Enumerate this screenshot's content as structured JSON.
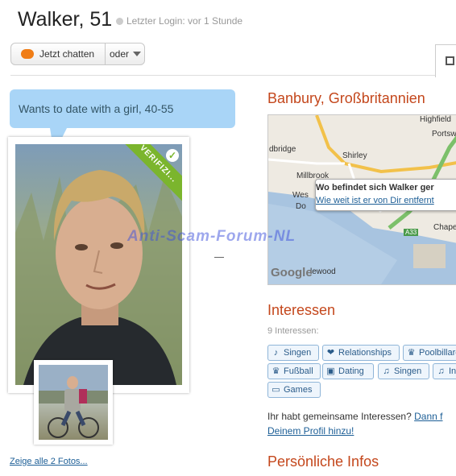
{
  "profile": {
    "name": "Walker, 51",
    "last_login": "Letzter Login: vor 1 Stunde"
  },
  "actions": {
    "chat_label": "Jetzt chatten",
    "or_label": "oder"
  },
  "looking_for": "Wants to date with a girl, 40-55",
  "photo": {
    "badge": "VERIFIZI...",
    "all_photos_link": "Zeige alle 2 Fotos..."
  },
  "location": {
    "title": "Banbury, Großbritannien"
  },
  "map": {
    "places": [
      "Highfield",
      "Portsw",
      "Shirley",
      "dbridge",
      "Millbrook",
      "Wes",
      "Do",
      "Chape",
      "lewood",
      "A33"
    ],
    "popup_title": "Wo befindet sich Walker ger",
    "popup_link": "Wie weit ist er von Dir entfernt",
    "brand": "Google"
  },
  "watermark": "Anti-Scam-Forum-NL",
  "interests": {
    "title": "Interessen",
    "count": "9 Interessen:",
    "tags": [
      {
        "label": "Singen",
        "icon": "music-note-icon"
      },
      {
        "label": "Relationships",
        "icon": "heart-icon"
      },
      {
        "label": "Poolbillard",
        "icon": "trophy-icon"
      },
      {
        "label": "Fußball",
        "icon": "trophy-icon"
      },
      {
        "label": "Dating",
        "icon": "briefcase-icon"
      },
      {
        "label": "Singen",
        "icon": "guitar-icon"
      },
      {
        "label": "In",
        "icon": "guitar-icon"
      },
      {
        "label": "Games",
        "icon": "tv-icon"
      }
    ],
    "common_text": "Ihr habt gemeinsame Interessen?",
    "common_link_1": "Dann f",
    "common_link_2": "Deinem Profil hinzu!"
  },
  "personal": {
    "title": "Persönliche Infos"
  },
  "colors": {
    "accent": "#c4471c",
    "link": "#1c5e96",
    "bubble": "#a9d5f7",
    "verified": "#7bb52d",
    "chat_icon": "#f07d16"
  }
}
